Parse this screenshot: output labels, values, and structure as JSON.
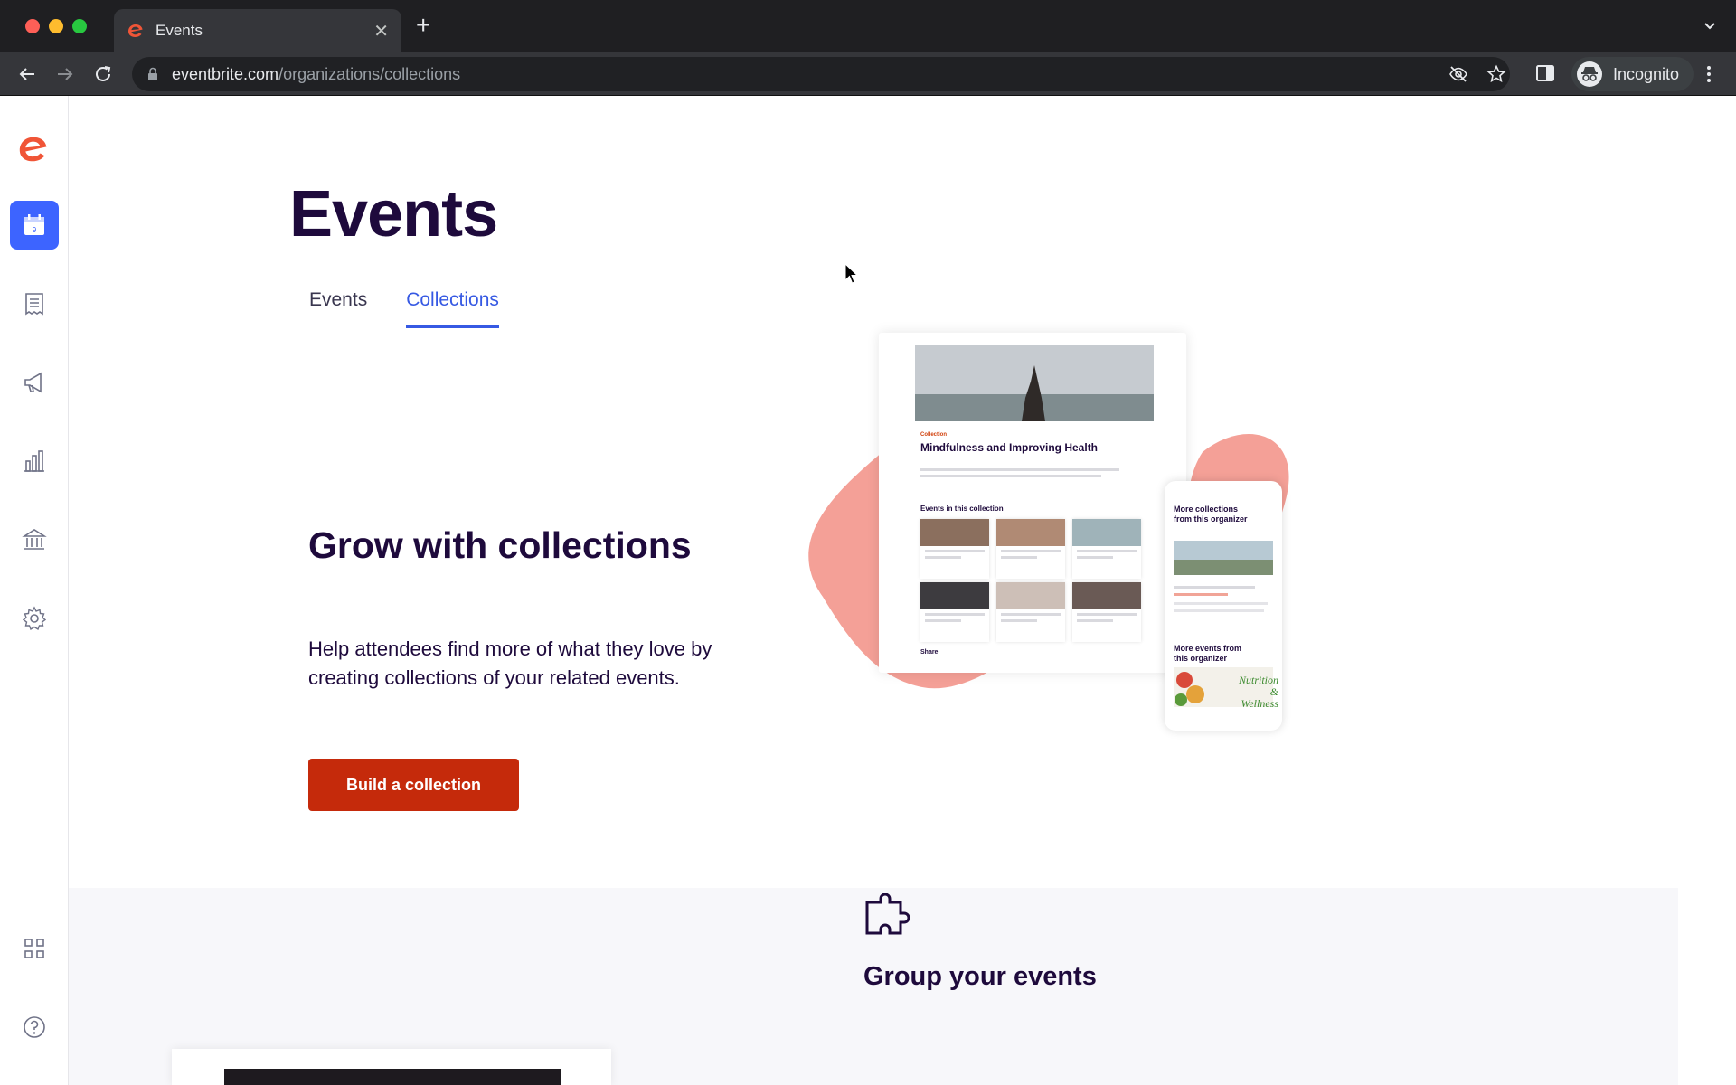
{
  "browser": {
    "tab_title": "Events",
    "url_host": "eventbrite.com",
    "url_path": "/organizations/collections",
    "profile_label": "Incognito"
  },
  "sidebar": {
    "items": [
      {
        "icon": "calendar-icon",
        "active": true
      },
      {
        "icon": "orders-icon"
      },
      {
        "icon": "megaphone-icon"
      },
      {
        "icon": "bar-chart-icon"
      },
      {
        "icon": "bank-icon"
      },
      {
        "icon": "gear-icon"
      },
      {
        "icon": "apps-grid-icon"
      },
      {
        "icon": "help-icon"
      }
    ]
  },
  "page": {
    "title": "Events",
    "tabs": [
      {
        "label": "Events",
        "active": false
      },
      {
        "label": "Collections",
        "active": true
      }
    ]
  },
  "hero": {
    "title": "Grow with collections",
    "description": "Help attendees find more of what they love by creating collections of your related events.",
    "cta_label": "Build a collection"
  },
  "illustration": {
    "collection_title": "Mindfulness and Improving Health",
    "section_label": "Events in this collection",
    "share_label": "Share",
    "phone_heading_1": "More collections from this organizer",
    "phone_heading_2": "More events from this organizer",
    "phone_image_text": "Nutrition & Wellness"
  },
  "band": {
    "title": "Group your events"
  },
  "colors": {
    "brand_red": "#c52a0b",
    "accent_blue": "#3659e3",
    "title_navy": "#1e0a3c",
    "blob_pink": "#f4a097"
  }
}
